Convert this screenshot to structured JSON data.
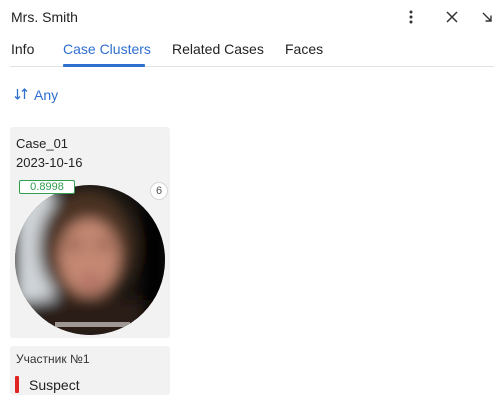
{
  "header": {
    "title": "Mrs. Smith",
    "icons": [
      "more-vertical-icon",
      "close-icon",
      "collapse-arrow-icon"
    ]
  },
  "tabs": [
    {
      "label": "Info",
      "active": false
    },
    {
      "label": "Case Clusters",
      "active": true
    },
    {
      "label": "Related Cases",
      "active": false
    },
    {
      "label": "Faces",
      "active": false
    }
  ],
  "sort": {
    "label": "Any",
    "icon": "sort-arrows-icon"
  },
  "card": {
    "case_name": "Case_01",
    "date": "2023-10-16",
    "score": "0.8998",
    "count": "6",
    "participant": "Участник №1",
    "status": "Suspect"
  },
  "colors": {
    "accent": "#2f6fd0",
    "score_green": "#2f9e4f",
    "suspect_red": "#e02424",
    "card_bg": "#f2f2f2"
  }
}
